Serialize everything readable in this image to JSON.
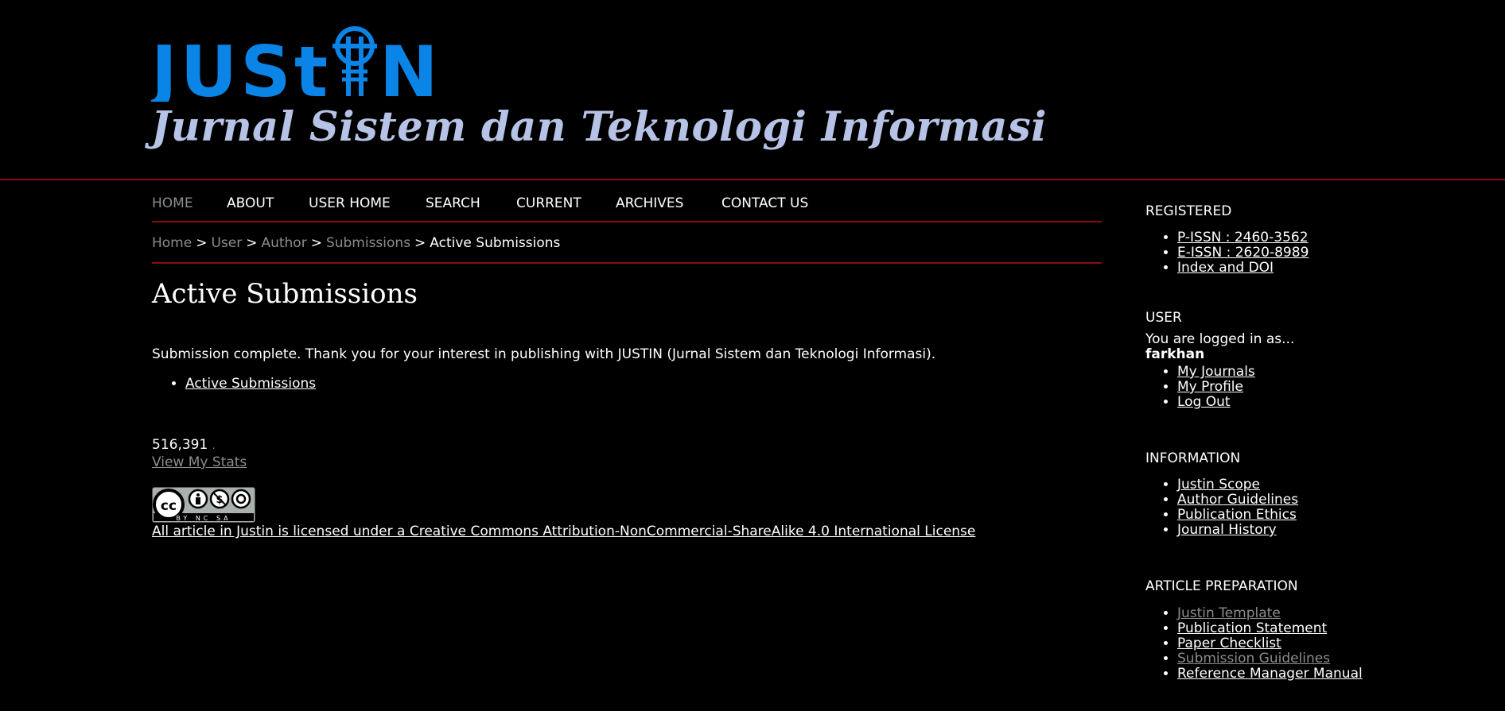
{
  "header": {
    "logo_text": "JUSTIN",
    "journal_name": "Jurnal Sistem dan Teknologi Informasi",
    "logo_color": "#0a84e6"
  },
  "nav": {
    "items": [
      {
        "label": "HOME",
        "active": true
      },
      {
        "label": "ABOUT"
      },
      {
        "label": "USER HOME"
      },
      {
        "label": "SEARCH"
      },
      {
        "label": "CURRENT"
      },
      {
        "label": "ARCHIVES"
      },
      {
        "label": "CONTACT US"
      }
    ]
  },
  "breadcrumb": {
    "items": [
      "Home",
      "User",
      "Author",
      "Submissions",
      "Active Submissions"
    ],
    "separator": ">"
  },
  "main": {
    "title": "Active Submissions",
    "message": "Submission complete. Thank you for your interest in publishing with JUSTIN (Jurnal Sistem dan Teknologi Informasi).",
    "links": [
      "Active Submissions"
    ],
    "stats_count": "516,391",
    "stats_dot": ".",
    "stats_link": "View My Stats",
    "cc_badge_text": "BY NC SA",
    "license_text": "All article in Justin is licensed under a Creative Commons Attribution-NonCommercial-ShareAlike 4.0 International License"
  },
  "sidebar": {
    "registered": {
      "title": "REGISTERED",
      "links": [
        "P-ISSN : 2460-3562",
        "E-ISSN : 2620-8989",
        "Index and DOI"
      ]
    },
    "user": {
      "title": "USER",
      "logged_in_label": "You are logged in as...",
      "username": "farkhan",
      "links": [
        "My Journals",
        "My Profile",
        "Log Out"
      ]
    },
    "information": {
      "title": "INFORMATION",
      "links": [
        "Justin Scope",
        "Author Guidelines",
        "Publication Ethics",
        "Journal History"
      ]
    },
    "article_preparation": {
      "title": "ARTICLE PREPARATION",
      "links": [
        "Justin Template",
        "Publication Statement",
        "Paper Checklist",
        "Submission Guidelines",
        "Reference Manager Manual"
      ]
    }
  }
}
